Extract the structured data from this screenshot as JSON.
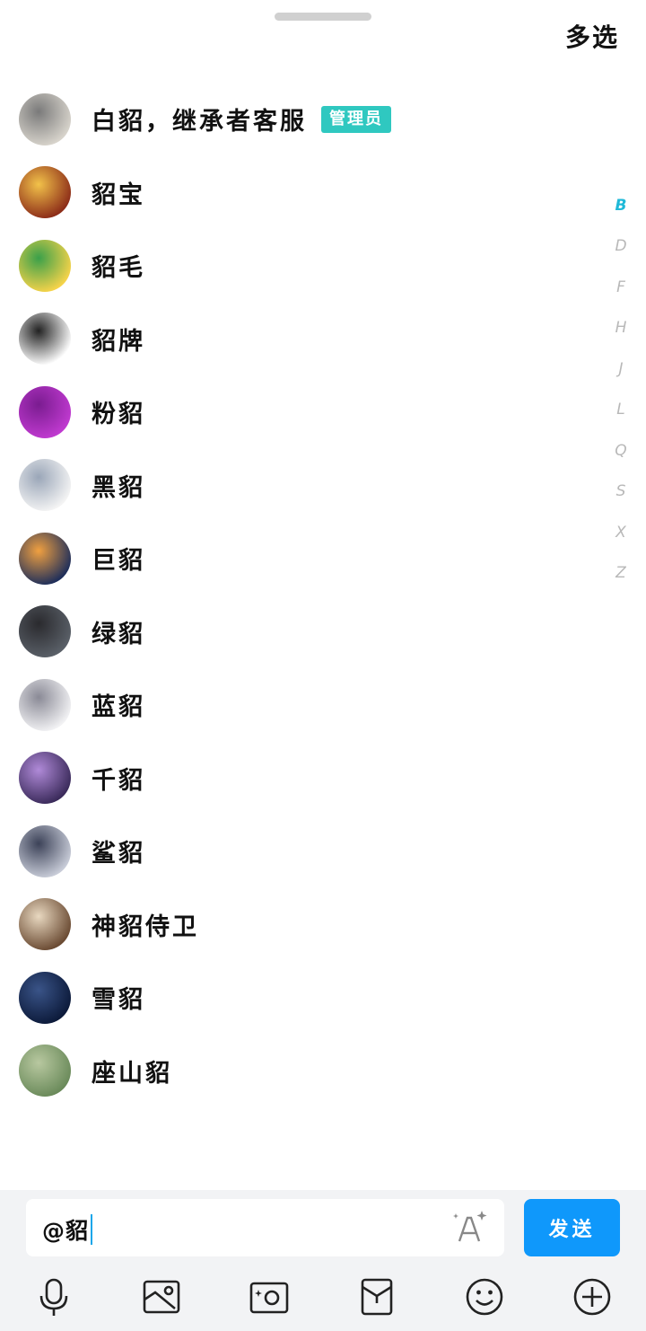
{
  "header": {
    "multi_select_label": "多选"
  },
  "members": [
    {
      "name": "白貂，继承者客服",
      "badge": "管理员",
      "avatar_icon": "hooded-knight-avatar",
      "avatar_colors": [
        "#d8d4cc",
        "#7a7a7a"
      ]
    },
    {
      "name": "貂宝",
      "badge": "",
      "avatar_icon": "cartoon-face-avatar",
      "avatar_colors": [
        "#8c2c18",
        "#f2c24a"
      ]
    },
    {
      "name": "貂毛",
      "badge": "",
      "avatar_icon": "pineapple-avatar",
      "avatar_colors": [
        "#f6d34a",
        "#3aa04a"
      ]
    },
    {
      "name": "貂牌",
      "badge": "",
      "avatar_icon": "panda-meme-avatar",
      "avatar_colors": [
        "#ffffff",
        "#222222"
      ]
    },
    {
      "name": "粉貂",
      "badge": "",
      "avatar_icon": "pink-cat-avatar",
      "avatar_colors": [
        "#c03ad0",
        "#7a1c90"
      ]
    },
    {
      "name": "黑貂",
      "badge": "",
      "avatar_icon": "sketch-cats-avatar",
      "avatar_colors": [
        "#f4f4f4",
        "#9aa6b8"
      ]
    },
    {
      "name": "巨貂",
      "badge": "",
      "avatar_icon": "sunset-silhouette-avatar",
      "avatar_colors": [
        "#1e2e5a",
        "#f0a040"
      ]
    },
    {
      "name": "绿貂",
      "badge": "",
      "avatar_icon": "couple-photo-avatar",
      "avatar_colors": [
        "#5a6068",
        "#2a2a2e"
      ]
    },
    {
      "name": "蓝貂",
      "badge": "",
      "avatar_icon": "anime-girl-avatar",
      "avatar_colors": [
        "#f2f2f4",
        "#8a8a96"
      ]
    },
    {
      "name": "千貂",
      "badge": "",
      "avatar_icon": "purple-ninja-avatar",
      "avatar_colors": [
        "#3a2a5a",
        "#b08ad8"
      ]
    },
    {
      "name": "鲨貂",
      "badge": "",
      "avatar_icon": "swordsman-avatar",
      "avatar_colors": [
        "#c8ccd8",
        "#3c4258"
      ]
    },
    {
      "name": "神貂侍卫",
      "badge": "",
      "avatar_icon": "temple-light-avatar",
      "avatar_colors": [
        "#6a4a32",
        "#e8d8c0"
      ]
    },
    {
      "name": "雪貂",
      "badge": "",
      "avatar_icon": "night-sky-avatar",
      "avatar_colors": [
        "#0c1a3a",
        "#3a5488"
      ]
    },
    {
      "name": "座山貂",
      "badge": "",
      "avatar_icon": "bamboo-avatar",
      "avatar_colors": [
        "#6a8a5a",
        "#b8c8a0"
      ]
    }
  ],
  "index_letters": [
    "B",
    "D",
    "F",
    "H",
    "J",
    "L",
    "Q",
    "S",
    "X",
    "Z"
  ],
  "index_active": "B",
  "composer": {
    "input_value": "@貂",
    "send_label": "发送"
  },
  "toolbar_icons": [
    "microphone-icon",
    "image-icon",
    "camera-icon",
    "red-packet-icon",
    "emoji-icon",
    "plus-circle-icon"
  ],
  "colors": {
    "accent": "#0f98fb",
    "badge": "#2fc8c0",
    "index_active": "#1fb9d8"
  }
}
